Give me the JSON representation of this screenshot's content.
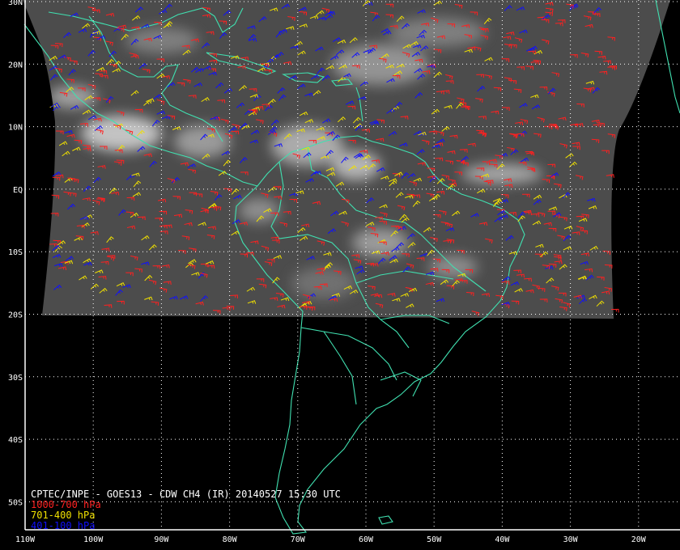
{
  "caption": {
    "title": "CPTEC/INPE - GOES13 - CDW CH4 (IR) 20140527 15:30 UTC"
  },
  "legend": [
    {
      "label": "1000-700 hPa",
      "color": "#ff2020"
    },
    {
      "label": "701-400 hPa",
      "color": "#f0e000"
    },
    {
      "label": "401-100 hPa",
      "color": "#1010ff"
    }
  ],
  "lat_labels": [
    {
      "text": "30N",
      "lat": 30
    },
    {
      "text": "20N",
      "lat": 20
    },
    {
      "text": "10N",
      "lat": 10
    },
    {
      "text": "EQ",
      "lat": 0
    },
    {
      "text": "10S",
      "lat": -10
    },
    {
      "text": "20S",
      "lat": -20
    },
    {
      "text": "30S",
      "lat": -30
    },
    {
      "text": "40S",
      "lat": -40
    },
    {
      "text": "50S",
      "lat": -50
    }
  ],
  "lon_labels": [
    {
      "text": "110W",
      "lon": -110
    },
    {
      "text": "100W",
      "lon": -100
    },
    {
      "text": "90W",
      "lon": -90
    },
    {
      "text": "80W",
      "lon": -80
    },
    {
      "text": "70W",
      "lon": -70
    },
    {
      "text": "60W",
      "lon": -60
    },
    {
      "text": "50W",
      "lon": -50
    },
    {
      "text": "40W",
      "lon": -40
    },
    {
      "text": "30W",
      "lon": -30
    },
    {
      "text": "20W",
      "lon": -20
    }
  ],
  "colors": {
    "coast": "#40e0b0",
    "grid": "#ffffff",
    "image_fill": "#505050",
    "background": "#000000"
  }
}
